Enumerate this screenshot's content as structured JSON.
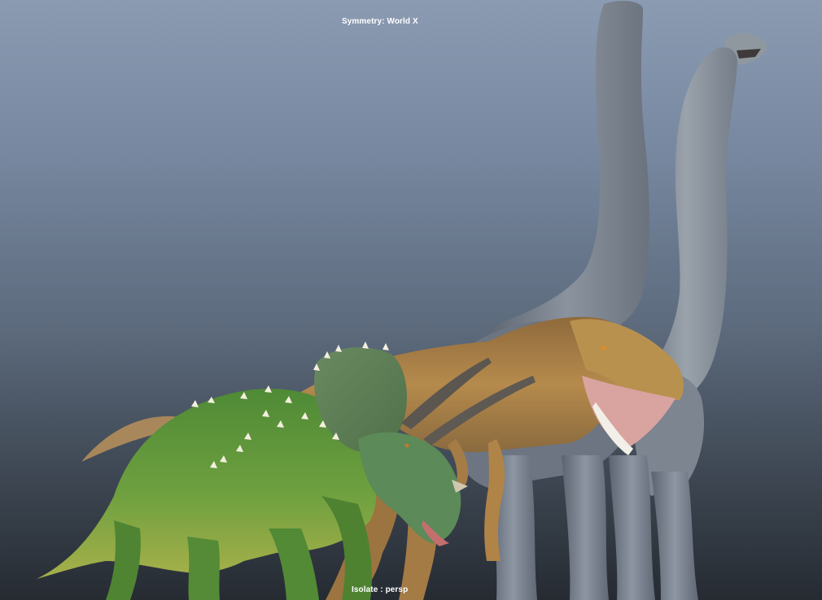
{
  "viewport": {
    "symmetry_label": "Symmetry: World X",
    "isolate_label": "Isolate : persp"
  },
  "scene": {
    "models": [
      "brachiosaurus-back",
      "brachiosaurus-front",
      "tyrannosaurus",
      "triceratops"
    ],
    "colors": {
      "sky_top": "#8a9bb2",
      "sky_bottom": "#262b32",
      "sauropod_gray": "#7d8794",
      "trex_brown": "#a97c42",
      "trike_green": "#5f9a3c"
    }
  }
}
